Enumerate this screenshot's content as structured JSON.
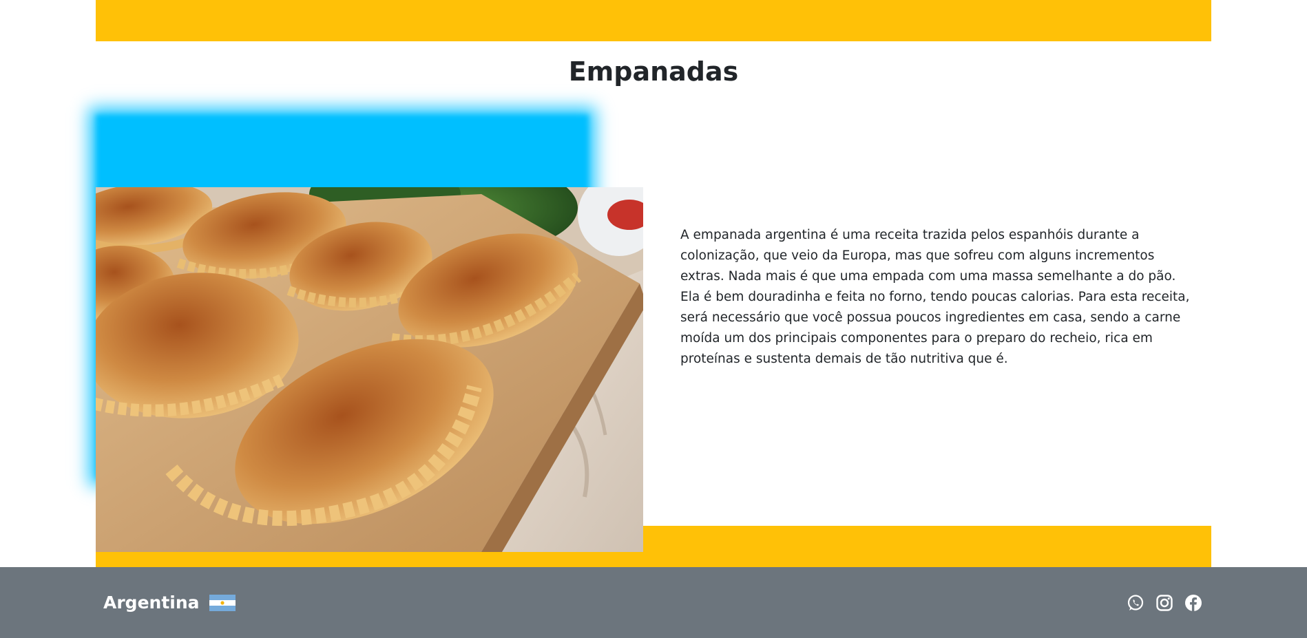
{
  "colors": {
    "accent_yellow": "#FFC107",
    "glow_blue": "#00BFFF",
    "footer_gray": "#6C757D",
    "text_dark": "#212529",
    "white": "#FFFFFF"
  },
  "main": {
    "title": "Empanadas",
    "description": "A empanada argentina é uma receita trazida pelos espanhóis durante a colonização, que veio da Europa, mas que sofreu com alguns incrementos extras. Nada mais é que uma empada com uma massa semelhante a do pão. Ela é bem douradinha e feita no forno, tendo poucas calorias. Para esta receita, será necessário que você possua poucos ingredientes em casa, sendo a carne moída um dos principais componentes para o preparo do recheio, rica em proteínas e sustenta demais de tão nutritiva que é.",
    "photo_icon": "empanadas-photo"
  },
  "footer": {
    "brand": "Argentina",
    "flag_icon": "argentina-flag-icon",
    "social_icons": [
      "whatsapp-icon",
      "instagram-icon",
      "facebook-icon"
    ]
  }
}
